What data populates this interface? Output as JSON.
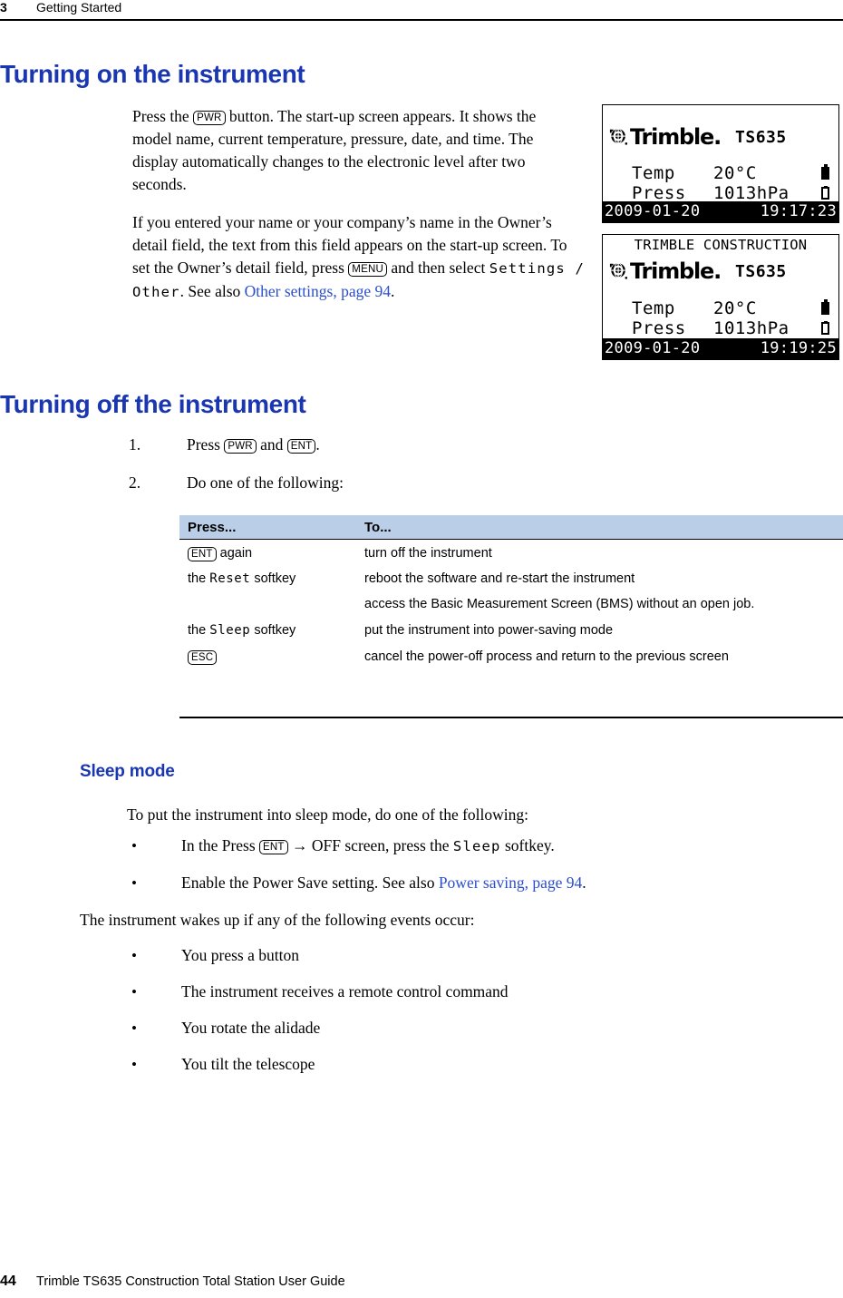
{
  "header": {
    "chapter_number": "3",
    "chapter_title": "Getting Started"
  },
  "sections": {
    "turning_on": {
      "heading": "Turning on the instrument",
      "para1_a": "Press the ",
      "para1_key": "PWR",
      "para1_b": " button. The start-up screen appears. It shows the model name, current temperature, pressure, date, and time. The display automatically changes to the electronic level after two seconds.",
      "para2_a": "If you entered your name or your company’s name in the Owner’s detail field, the text from this field appears on the start-up screen. To set the Owner’s detail field, press ",
      "para2_key": "MENU",
      "para2_b": " and then select ",
      "para2_mono": "Settings / Other",
      "para2_c": ". See also ",
      "para2_link": "Other settings, page 94",
      "para2_d": "."
    },
    "turning_off": {
      "heading": "Turning off the instrument",
      "steps": [
        {
          "number": "1.",
          "text_a": "Press ",
          "key1": "PWR",
          "text_b": " and ",
          "key2": "ENT",
          "text_c": "."
        },
        {
          "number": "2.",
          "text_a": "Do one of the following:",
          "key1": "",
          "text_b": "",
          "key2": "",
          "text_c": ""
        }
      ]
    },
    "sleep_mode": {
      "heading": "Sleep mode",
      "intro": "To put the instrument into sleep mode, do one of the following:",
      "bullets": [
        {
          "a": "In the Press ",
          "key": "ENT",
          "b": " → OFF screen, press the ",
          "mono": "Sleep",
          "c": " softkey."
        },
        {
          "a": "Enable the Power Save setting. See also ",
          "key": "",
          "b": "",
          "mono": "",
          "c": "",
          "link": "Power saving, page 94",
          "tail": "."
        }
      ],
      "wake_intro": "The instrument wakes up if any of the following events occur:",
      "wake_bullets": [
        "You press a button",
        "The instrument receives a remote control command",
        "You rotate the alidade",
        "You tilt the telescope"
      ]
    }
  },
  "table": {
    "columns": [
      "Press...",
      "To..."
    ],
    "rows": [
      {
        "press_prefix": "",
        "press_key": "ENT",
        "press_mono": "",
        "press_suffix": " again",
        "to_lines": [
          "turn off the instrument"
        ]
      },
      {
        "press_prefix": "the ",
        "press_key": "",
        "press_mono": "Reset",
        "press_suffix": " softkey",
        "to_lines": [
          "reboot the software and re-start the instrument",
          "access the Basic Measurement Screen (BMS) without an open job."
        ]
      },
      {
        "press_prefix": "the ",
        "press_key": "",
        "press_mono": "Sleep",
        "press_suffix": " softkey",
        "to_lines": [
          "put the instrument into power-saving mode"
        ]
      },
      {
        "press_prefix": "",
        "press_key": "ESC",
        "press_mono": "",
        "press_suffix": "",
        "to_lines": [
          "cancel the power-off process and return to the previous screen"
        ]
      }
    ]
  },
  "lcd_screens": [
    {
      "owner_line": "",
      "brand": "Trimble.",
      "model": "TS635",
      "temp_label": "Temp",
      "temp_value": "20°C",
      "press_label": "Press",
      "press_value": "1013hPa",
      "date": "2009-01-20",
      "time": "19:17:23"
    },
    {
      "owner_line": "TRIMBLE CONSTRUCTION",
      "brand": "Trimble.",
      "model": "TS635",
      "temp_label": "Temp",
      "temp_value": "20°C",
      "press_label": "Press",
      "press_value": "1013hPa",
      "date": "2009-01-20",
      "time": "19:19:25"
    }
  ],
  "footer": {
    "page_number": "44",
    "guide_title": "Trimble TS635 Construction Total Station User Guide"
  },
  "colors": {
    "heading_blue": "#1a36b0",
    "link_blue": "#2b4ecf",
    "table_header_bg": "#bacfe7"
  }
}
